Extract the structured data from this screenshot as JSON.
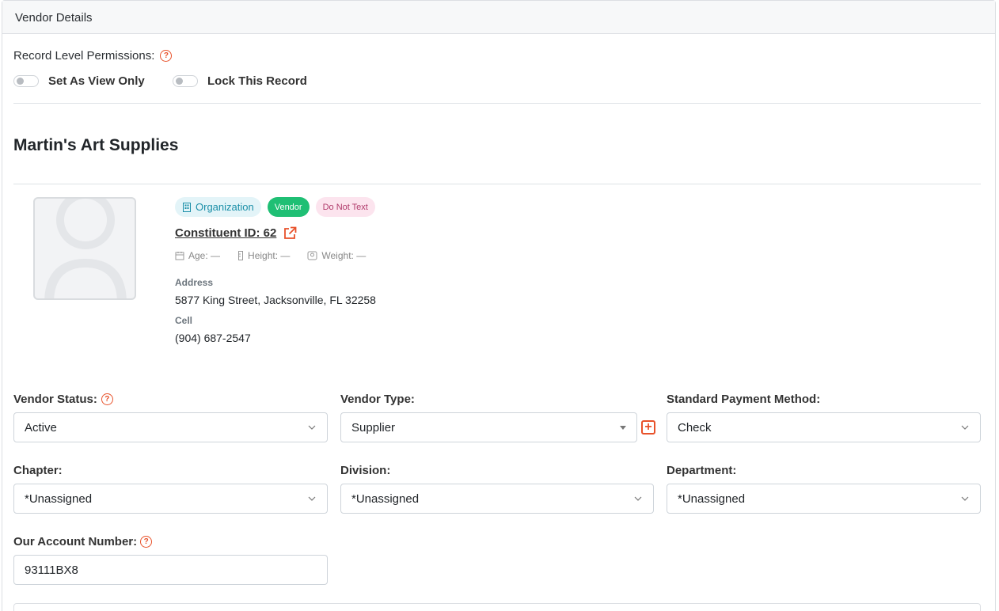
{
  "card": {
    "header_title": "Vendor Details"
  },
  "permissions": {
    "label": "Record Level Permissions:",
    "toggles": [
      {
        "label": "Set As View Only",
        "on": false
      },
      {
        "label": "Lock This Record",
        "on": false
      }
    ]
  },
  "vendor": {
    "name": "Martin's Art Supplies",
    "badges": {
      "organization": "Organization",
      "vendor": "Vendor",
      "do_not_text": "Do Not Text"
    },
    "constituent_id_label": "Constituent ID: 62",
    "stats": {
      "age": "Age: —",
      "height": "Height: —",
      "weight": "Weight: —"
    },
    "address_label": "Address",
    "address_value": "5877 King Street, Jacksonville, FL 32258",
    "cell_label": "Cell",
    "cell_value": "(904) 687-2547"
  },
  "form": {
    "vendor_status": {
      "label": "Vendor Status:",
      "value": "Active"
    },
    "vendor_type": {
      "label": "Vendor Type:",
      "value": "Supplier"
    },
    "payment_method": {
      "label": "Standard Payment Method:",
      "value": "Check"
    },
    "chapter": {
      "label": "Chapter:",
      "value": "*Unassigned"
    },
    "division": {
      "label": "Division:",
      "value": "*Unassigned"
    },
    "department": {
      "label": "Department:",
      "value": "*Unassigned"
    },
    "account_number": {
      "label": "Our Account Number:",
      "value": "93111BX8"
    }
  },
  "colors": {
    "accent": "#e8512a",
    "vendor_badge": "#1fbf74",
    "org_badge_text": "#1b8fa8",
    "dnt_badge_text": "#b03a6b"
  }
}
